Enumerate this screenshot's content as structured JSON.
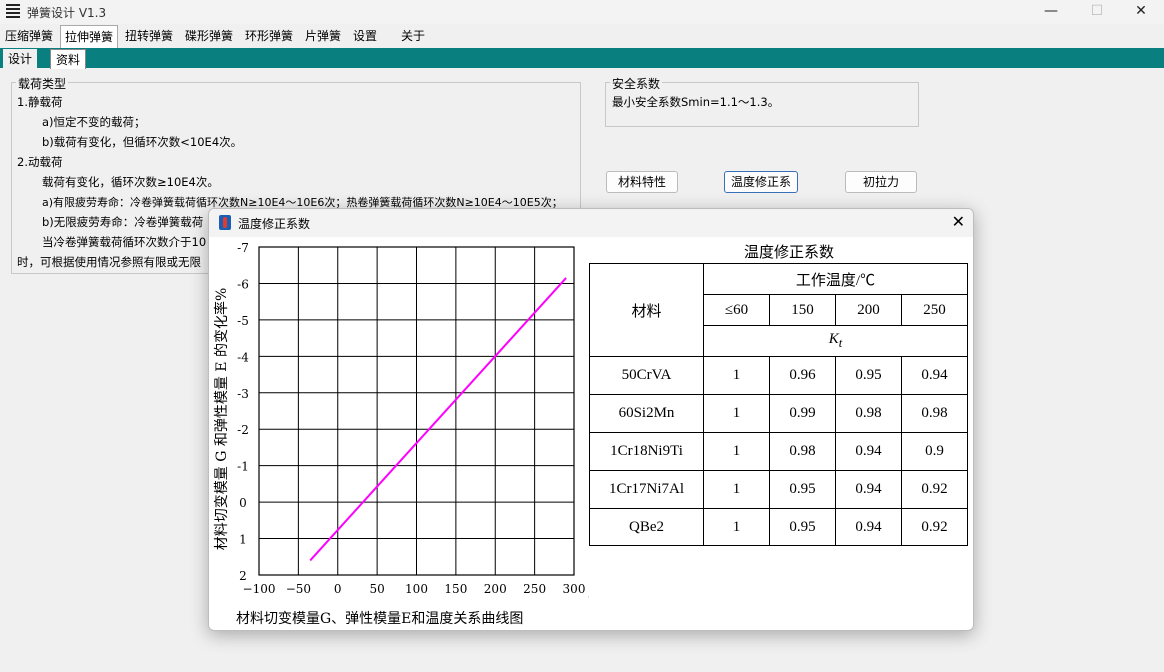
{
  "window": {
    "title": "弹簧设计  V1.3",
    "minimize": "—",
    "maximize": "☐",
    "close": "✕"
  },
  "menu": [
    "压缩弹簧",
    "拉伸弹簧",
    "扭转弹簧",
    "碟形弹簧",
    "环形弹簧",
    "片弹簧",
    "设置",
    "关于"
  ],
  "active_menu": "拉伸弹簧",
  "subtabs": [
    "设计",
    "资料"
  ],
  "load": {
    "title": "载荷类型",
    "lines": [
      "1.静载荷",
      "a)恒定不变的载荷；",
      "b)载荷有变化，但循环次数<10E4次。",
      "2.动载荷",
      "载荷有变化，循环次数≥10E4次。",
      "a)有限疲劳寿命：冷卷弹簧载荷循环次数N≥10E4～10E6次；热卷弹簧载荷循环次数N≥10E4～10E5次；",
      "b)无限疲劳寿命：冷卷弹簧载荷",
      "当冷卷弹簧载荷循环次数介于10",
      "时，可根据使用情况参照有限或无限"
    ]
  },
  "safety": {
    "title": "安全系数",
    "text": "最小安全系数Smin=1.1～1.3。"
  },
  "buttons": {
    "material": "材料特性",
    "temp": "温度修正系",
    "initial": "初拉力"
  },
  "dialog": {
    "title": "温度修正系数",
    "close": "✕",
    "chart_caption": "材料切变模量G、弹性模量E和温度关系曲线图",
    "table": {
      "title": "温度修正系数",
      "header_material": "材料",
      "header_temp": "工作温度/℃",
      "temps": [
        "≤60",
        "150",
        "200",
        "250"
      ],
      "kt": "K",
      "kt_sub": "t",
      "rows": [
        {
          "material": "50CrVA",
          "values": [
            "1",
            "0.96",
            "0.95",
            "0.94"
          ]
        },
        {
          "material": "60Si2Mn",
          "values": [
            "1",
            "0.99",
            "0.98",
            "0.98"
          ]
        },
        {
          "material": "1Cr18Ni9Ti",
          "values": [
            "1",
            "0.98",
            "0.94",
            "0.9"
          ]
        },
        {
          "material": "1Cr17Ni7Al",
          "values": [
            "1",
            "0.95",
            "0.94",
            "0.92"
          ]
        },
        {
          "material": "QBe2",
          "values": [
            "1",
            "0.95",
            "0.94",
            "0.92"
          ]
        }
      ]
    }
  },
  "chart_data": {
    "type": "line",
    "xlabel": "工作温度/℃",
    "ylabel": "材料切变模量 G 和弹性模量 E 的变化率%",
    "x_ticks": [
      "−100",
      "−50",
      "0",
      "50",
      "100",
      "150",
      "200",
      "250",
      "300"
    ],
    "y_ticks": [
      "-7",
      "-6",
      "-5",
      "-4",
      "-3",
      "-2",
      "-1",
      "0",
      "1",
      "2"
    ],
    "xlim": [
      -100,
      300
    ],
    "ylim": [
      2,
      -7
    ],
    "y_inverted": true,
    "grid": true,
    "line_color": "#ff00ff",
    "series": [
      {
        "x": [
          -35,
          290
        ],
        "y": [
          1.6,
          -6.15
        ]
      }
    ]
  }
}
